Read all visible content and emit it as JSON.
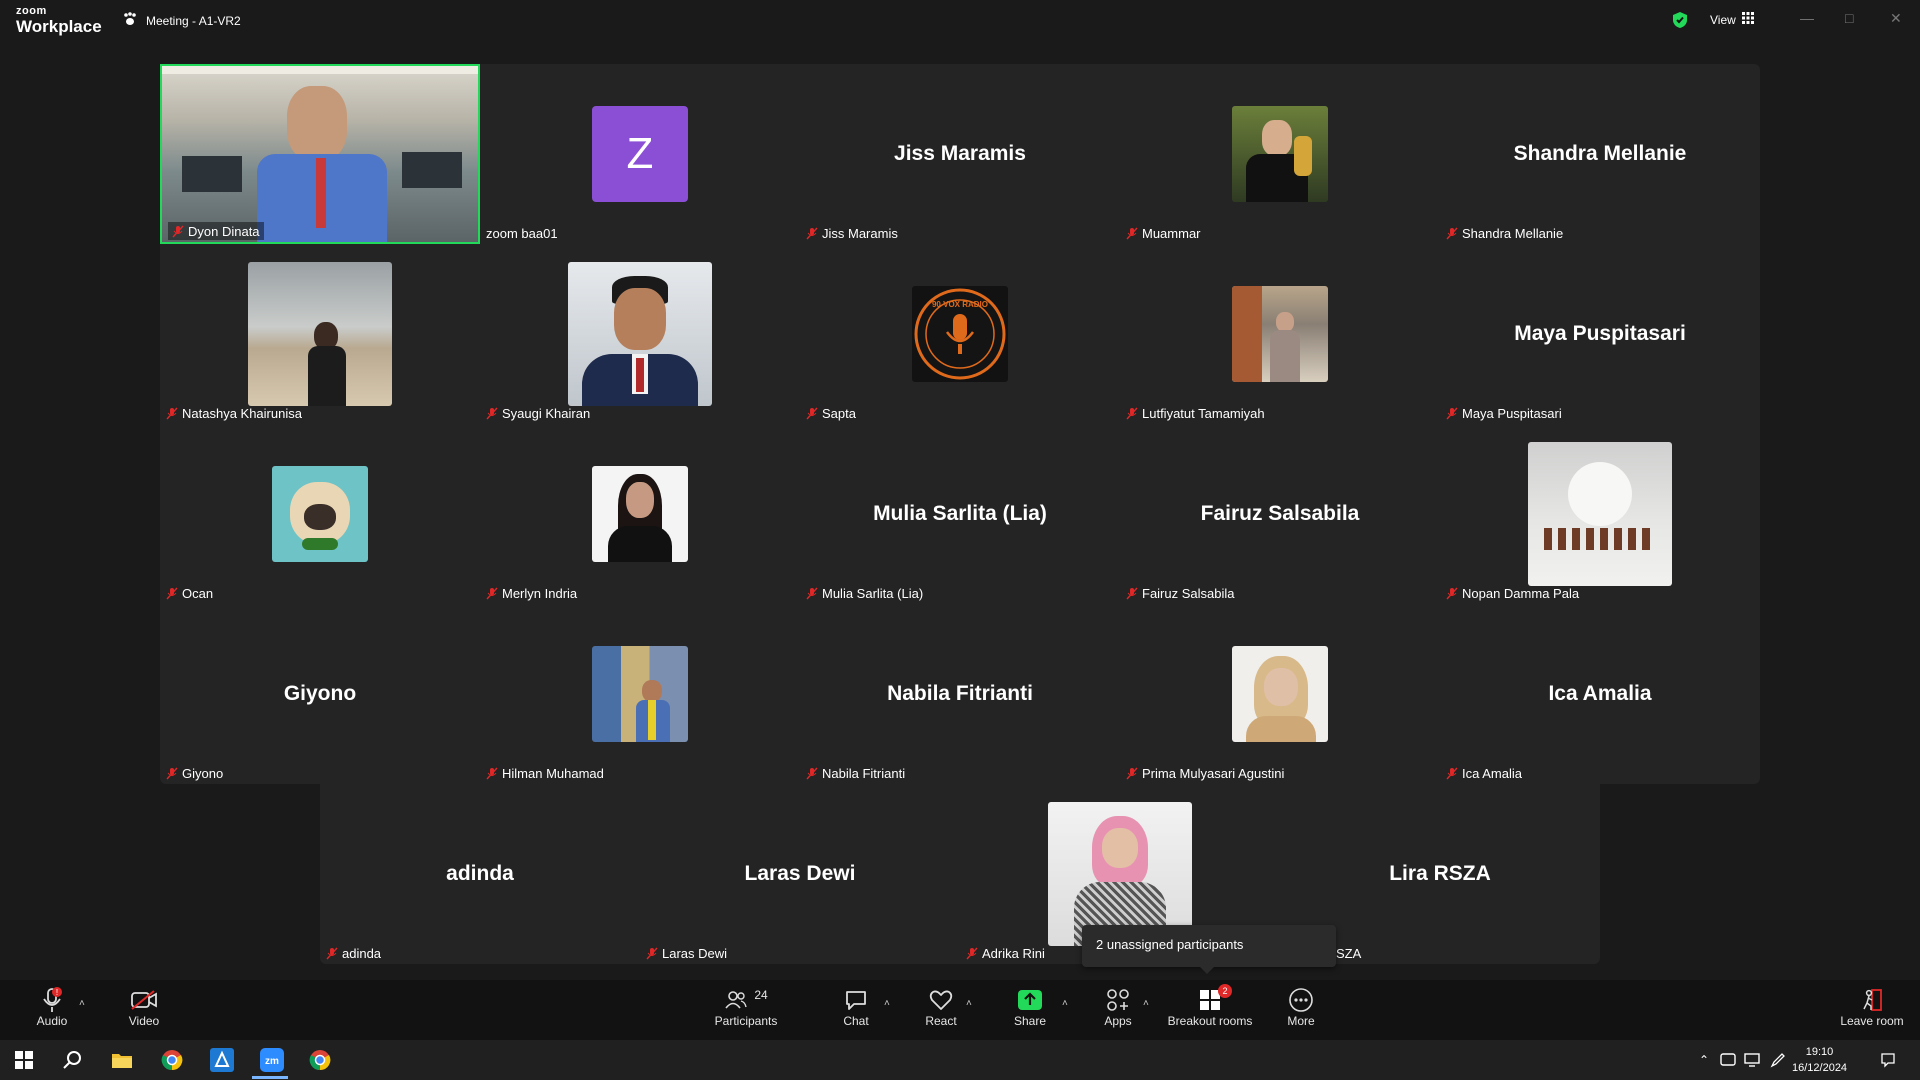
{
  "app": {
    "logo_top": "zoom",
    "logo_bottom": "Workplace",
    "meeting_title": "Meeting - A1-VR2",
    "view_label": "View"
  },
  "participants_tiles": [
    {
      "display": "video",
      "label": "Dyon Dinata",
      "muted": true,
      "active_speaker": true
    },
    {
      "display": "avatar-letter",
      "letter": "Z",
      "label": "zoom baa01",
      "muted": false
    },
    {
      "display": "name",
      "big_name": "Jiss Maramis",
      "label": "Jiss Maramis",
      "muted": true
    },
    {
      "display": "photo",
      "label": "Muammar",
      "muted": true
    },
    {
      "display": "name",
      "big_name": "Shandra Mellanie",
      "label": "Shandra Mellanie",
      "muted": true
    },
    {
      "display": "photo",
      "label": "Natashya Khairunisa",
      "muted": true
    },
    {
      "display": "photo",
      "label": "Syaugi Khairan",
      "muted": true
    },
    {
      "display": "photo",
      "label": "Sapta",
      "muted": true,
      "logo_text": "90 VOX RADIO"
    },
    {
      "display": "photo",
      "label": "Lutfiyatut Tamamiyah",
      "muted": true
    },
    {
      "display": "name",
      "big_name": "Maya Puspitasari",
      "label": "Maya Puspitasari",
      "muted": true
    },
    {
      "display": "photo",
      "label": "Ocan",
      "muted": true
    },
    {
      "display": "photo",
      "label": "Merlyn Indria",
      "muted": true
    },
    {
      "display": "name",
      "big_name": "Mulia Sarlita (Lia)",
      "label": "Mulia Sarlita (Lia)",
      "muted": true
    },
    {
      "display": "name",
      "big_name": "Fairuz Salsabila",
      "label": "Fairuz Salsabila",
      "muted": true
    },
    {
      "display": "photo",
      "label": "Nopan Damma Pala",
      "muted": true
    },
    {
      "display": "name",
      "big_name": "Giyono",
      "label": "Giyono",
      "muted": true
    },
    {
      "display": "photo",
      "label": "Hilman Muhamad",
      "muted": true
    },
    {
      "display": "name",
      "big_name": "Nabila Fitrianti",
      "label": "Nabila Fitrianti",
      "muted": true
    },
    {
      "display": "photo",
      "label": "Prima Mulyasari Agustini",
      "muted": true
    },
    {
      "display": "name",
      "big_name": "Ica Amalia",
      "label": "Ica Amalia",
      "muted": true
    },
    {
      "display": "name",
      "big_name": "adinda",
      "label": "adinda",
      "muted": true
    },
    {
      "display": "name",
      "big_name": "Laras Dewi",
      "label": "Laras Dewi",
      "muted": true
    },
    {
      "display": "photo",
      "label": "Adrika Rini",
      "muted": true
    },
    {
      "display": "name",
      "big_name": "Lira RSZA",
      "label": "SZA",
      "muted": false
    }
  ],
  "tooltip": "2 unassigned participants",
  "toolbar": {
    "audio": "Audio",
    "video": "Video",
    "participants": "Participants",
    "participants_count": "24",
    "chat": "Chat",
    "react": "React",
    "share": "Share",
    "apps": "Apps",
    "breakout_rooms": "Breakout rooms",
    "breakout_badge": "2",
    "more": "More",
    "leave_room": "Leave room"
  },
  "taskbar": {
    "time": "19:10",
    "date": "16/12/2024"
  },
  "colors": {
    "active_speaker": "#23d959",
    "muted_red": "#e02828",
    "share_green": "#23d959"
  }
}
